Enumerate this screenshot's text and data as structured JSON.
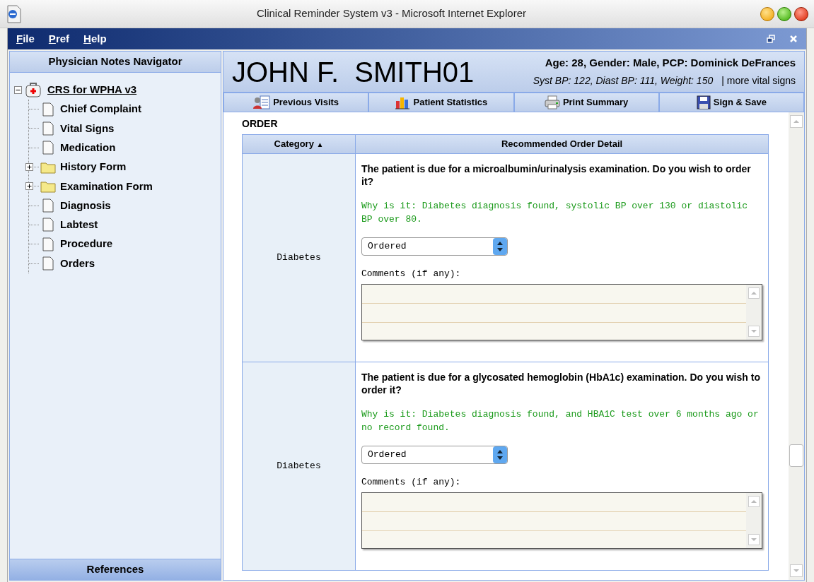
{
  "window": {
    "title": "Clinical Reminder System v3 - Microsoft Internet Explorer"
  },
  "menu": [
    {
      "label": "File",
      "mnemonic_underlined": true
    },
    {
      "label": "Pref",
      "mnemonic_underlined": true
    },
    {
      "label": "Help",
      "mnemonic_underlined": true
    }
  ],
  "navigator": {
    "title": "Physician Notes Navigator",
    "tree": {
      "label": "CRS for WPHA v3",
      "expanded": true,
      "children": [
        {
          "label": "Chief Complaint",
          "kind": "document"
        },
        {
          "label": "Vital Signs",
          "kind": "document"
        },
        {
          "label": "Medication",
          "kind": "document"
        },
        {
          "label": "History Form",
          "kind": "folder",
          "expanded": false
        },
        {
          "label": "Examination Form",
          "kind": "folder",
          "expanded": false
        },
        {
          "label": "Diagnosis",
          "kind": "document"
        },
        {
          "label": "Labtest",
          "kind": "document"
        },
        {
          "label": "Procedure",
          "kind": "document"
        },
        {
          "label": "Orders",
          "kind": "document"
        }
      ]
    },
    "footer": "References"
  },
  "patient": {
    "name": "JOHN F.  SMITH01",
    "summary": "Age: 28, Gender: Male, PCP: Dominick DeFrances",
    "vitals": "Syst BP: 122, Diast BP: 111, Weight: 150",
    "more_link": "| more vital signs"
  },
  "toolbar": [
    {
      "label": "Previous Visits",
      "kind": "visits"
    },
    {
      "label": "Patient Statistics",
      "kind": "stats"
    },
    {
      "label": "Print Summary",
      "kind": "print"
    },
    {
      "label": "Sign & Save",
      "kind": "save"
    }
  ],
  "section_title": "ORDER",
  "table": {
    "columns": [
      "Category",
      "Recommended Order Detail"
    ],
    "sort_indicator": "▲",
    "rows": [
      {
        "category": "Diabetes",
        "question": "The patient is due for a microalbumin/urinalysis examination. Do you wish to order it?",
        "reason": "Why is it: Diabetes diagnosis found, systolic BP over 130 or diastolic BP over 80.",
        "choice": "Ordered",
        "comments_label": "Comments (if any):"
      },
      {
        "category": "Diabetes",
        "question": "The patient is due for a glycosated hemoglobin (HbA1c) examination. Do you wish to order it?",
        "reason": "Why is it: Diabetes diagnosis found, and HBA1C test over 6 months ago or no record found.",
        "choice": "Ordered",
        "comments_label": "Comments (if any):"
      }
    ]
  }
}
